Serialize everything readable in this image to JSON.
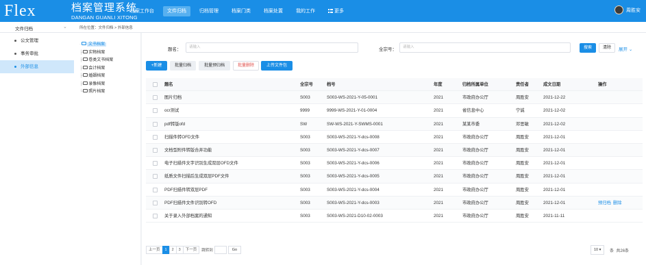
{
  "app": {
    "logo": "Flex",
    "title": "档案管理系统",
    "subtitle": "DANGAN GUANLI XITONG",
    "user": "周胜安"
  },
  "nav": [
    {
      "label": "档案工作台",
      "active": false
    },
    {
      "label": "文件归档",
      "active": true
    },
    {
      "label": "归档管理",
      "active": false
    },
    {
      "label": "档案门类",
      "active": false
    },
    {
      "label": "档案处置",
      "active": false
    },
    {
      "label": "我的工作",
      "active": false
    },
    {
      "label": "更多",
      "active": false
    }
  ],
  "sidebar": {
    "header": "文件归档",
    "items": [
      {
        "label": "公文管理",
        "active": false
      },
      {
        "label": "事务审批",
        "active": false
      },
      {
        "label": "外部信息",
        "active": true
      }
    ]
  },
  "breadcrumb": "所在位置：文件归档 > 外部信息",
  "tree": [
    {
      "label": "文书档案",
      "active": true
    },
    {
      "label": "实物档案",
      "active": false
    },
    {
      "label": "卷类文书档案",
      "active": false
    },
    {
      "label": "会计档案",
      "active": false
    },
    {
      "label": "婚姻档案",
      "active": false
    },
    {
      "label": "录像档案",
      "active": false
    },
    {
      "label": "照片档案",
      "active": false
    }
  ],
  "filters": {
    "title_label": "题名：",
    "title_placeholder": "请输入",
    "fonds_label": "全宗号：",
    "fonds_placeholder": "请输入",
    "search": "搜索",
    "clear": "清除",
    "expand": "展开"
  },
  "toolbar": {
    "new": "+新建",
    "batch_archive": "批量归档",
    "batch_pre": "批量预归档",
    "batch_delete": "批量删除",
    "upload": "上传文件包"
  },
  "table": {
    "headers": [
      "题名",
      "全宗号",
      "档号",
      "年度",
      "归档所属单位",
      "责任者",
      "成文日期",
      "操作"
    ],
    "rows": [
      {
        "title": "图片归档",
        "fonds": "S003",
        "code": "S003-WS-2021-Y-05-0001",
        "year": "2021",
        "unit": "市政府办公厅",
        "owner": "周胜安",
        "date": "2021-12-22",
        "ops": []
      },
      {
        "title": "ocr测试",
        "fonds": "9999",
        "code": "9999-WS-2021-Y-01-0004",
        "year": "2021",
        "unit": "省信息中心",
        "owner": "宁诚",
        "date": "2021-12-02",
        "ops": []
      },
      {
        "title": "pdf转版ofd",
        "fonds": "SW",
        "code": "SW-WS-2021-Y-SWMS-0001",
        "year": "2021",
        "unit": "某某市委",
        "owner": "邓思敏",
        "date": "2021-12-02",
        "ops": []
      },
      {
        "title": "扫描件转OFD文件",
        "fonds": "S003",
        "code": "S003-WS-2021-Y-dcs-0008",
        "year": "2021",
        "unit": "市政府办公厅",
        "owner": "周胜安",
        "date": "2021-12-01",
        "ops": []
      },
      {
        "title": "文档型附件转版合并功能",
        "fonds": "S003",
        "code": "S003-WS-2021-Y-dcs-0007",
        "year": "2021",
        "unit": "市政府办公厅",
        "owner": "周胜安",
        "date": "2021-12-01",
        "ops": []
      },
      {
        "title": "电子扫描件文字识别生成双层OFD文件",
        "fonds": "S003",
        "code": "S003-WS-2021-Y-dcs-0006",
        "year": "2021",
        "unit": "市政府办公厅",
        "owner": "周胜安",
        "date": "2021-12-01",
        "ops": []
      },
      {
        "title": "纸质文件扫描后生成双层PDF文件",
        "fonds": "S003",
        "code": "S003-WS-2021-Y-dcs-0005",
        "year": "2021",
        "unit": "市政府办公厅",
        "owner": "周胜安",
        "date": "2021-12-01",
        "ops": []
      },
      {
        "title": "PDF扫描件转双层PDF",
        "fonds": "S003",
        "code": "S003-WS-2021-Y-dcs-0004",
        "year": "2021",
        "unit": "市政府办公厅",
        "owner": "周胜安",
        "date": "2021-12-01",
        "ops": []
      },
      {
        "title": "PDF扫描件文件识别转OFD",
        "fonds": "S003",
        "code": "S003-WS-2021-Y-dcs-0003",
        "year": "2021",
        "unit": "市政府办公厅",
        "owner": "周胜安",
        "date": "2021-12-01",
        "ops": [
          "预归档",
          "删除"
        ]
      },
      {
        "title": "关于录入外部档案的通知",
        "fonds": "S003",
        "code": "S003-WS-2021-D10-02-0003",
        "year": "2021",
        "unit": "市政府办公厅",
        "owner": "周胜安",
        "date": "2021-11-11",
        "ops": []
      }
    ]
  },
  "pagination": {
    "prev": "上一页",
    "pages": [
      "1",
      "2",
      "3"
    ],
    "current": "1",
    "next": "下一页",
    "goto": "跳转到",
    "go": "Go",
    "page_size": "10 ▾",
    "per_page": "条",
    "total": "共26条"
  },
  "colors": {
    "primary": "#1a8ee6",
    "danger": "#e0504c"
  }
}
